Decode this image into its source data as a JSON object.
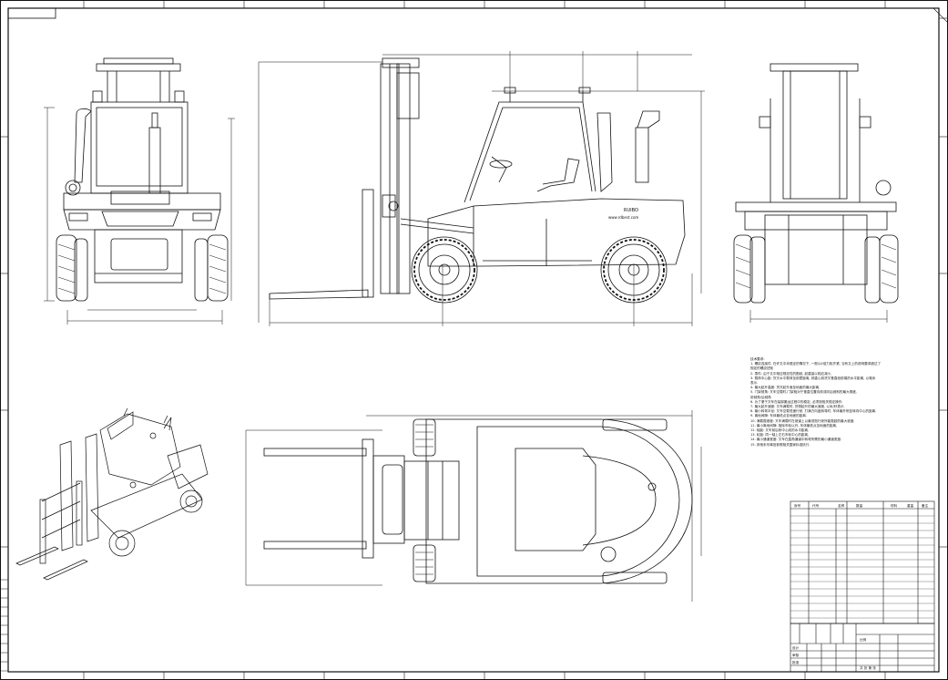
{
  "drawing": {
    "brand_text": "RUIBO",
    "website_text": "www.rdbest.com"
  },
  "notes": {
    "title": "技术要求:",
    "lines": [
      "1. 螺纹连接件, 在许文中未规定的情况下, 一般以4倍力矩拧紧, 当有文上的说明要求超过了",
      "规定的螺纹扭矩",
      "2. 零件: 由于文中相应规定性的图纸, 起重量以相应减小,",
      "3. 载荷中心距: 货叉水平载荷至前壁距离, 其重心到货叉垂直段前端的水平距离, 以毫米",
      "表示.",
      "4. 最大起升高度: 货叉起升面至地面的最大距离,",
      "5. 门架倾角: 叉车空载时,门架相对于垂直位置向前或向后倾斜的最大角度,",
      "前倾角/后倾角",
      "6. 为了便于叉车在装卸搬运过程中的稳定, 必须按相关规定操作.",
      "7. 最大起升速度: 叉车满载时, 货物起升的最大速度, 以米/秒表示.",
      "8. 最小转弯半径: 叉车空载低速行驶, 打满方向盘转弯时, 车体最外侧至转向中心的距离.",
      "9. 离地间隙: 车体最低点至地面的距离.",
      "10. 满载爬坡度: 叉车满载时在坡道上以最低档行驶所能爬越的最大坡度.",
      "11. 最小离地间隙: 指除车轮以外, 车体最低点至地面的距离,",
      "12. 轴距: 叉车前后桥中心线的水平距离,",
      "13. 轮距: 同一轴上左右车轮中心的距离,",
      "14. 最小通道宽度: 叉车在直角通道中转弯所需的最小通道宽度.",
      "15. 其他未尽事宜参照相关国家标准执行."
    ]
  },
  "title_block": {
    "header_cells": [
      "序号",
      "代号",
      "名称",
      "数量",
      "材料",
      "重量",
      "备注"
    ],
    "scale_label": "比例",
    "sheet_label": "共 张 第 张",
    "designer_label": "设计",
    "checker_label": "审核",
    "approval_label": "批准"
  }
}
